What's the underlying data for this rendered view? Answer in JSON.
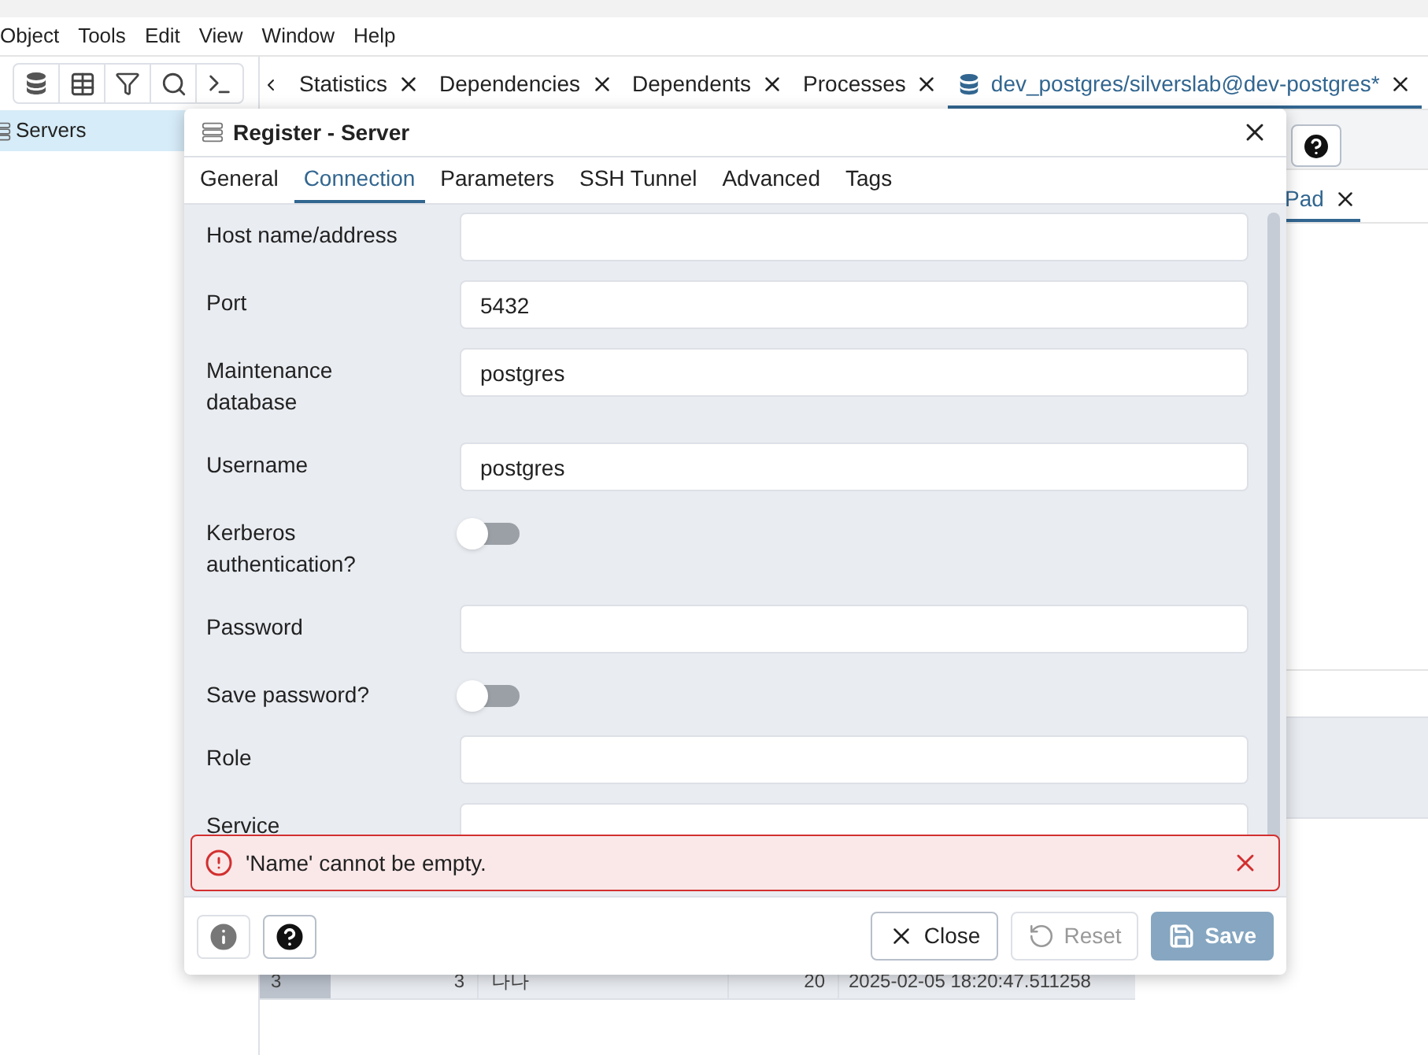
{
  "menu": [
    "Object",
    "Tools",
    "Edit",
    "View",
    "Window",
    "Help"
  ],
  "tabs": [
    {
      "label": "Statistics",
      "selected": false,
      "icon": false
    },
    {
      "label": "Dependencies",
      "selected": false,
      "icon": false
    },
    {
      "label": "Dependents",
      "selected": false,
      "icon": false
    },
    {
      "label": "Processes",
      "selected": false,
      "icon": false
    },
    {
      "label": "dev_postgres/silverslab@dev-postgres*",
      "selected": true,
      "icon": true
    }
  ],
  "tree": [
    {
      "label": "Servers",
      "selected": true
    }
  ],
  "background": {
    "pad_tab": "Pad",
    "row": [
      "3",
      "3",
      "나나",
      "20",
      "2025-02-05 18:20:47.511258"
    ]
  },
  "dialog": {
    "title": "Register - Server",
    "tabs": [
      {
        "label": "General",
        "selected": false
      },
      {
        "label": "Connection",
        "selected": true
      },
      {
        "label": "Parameters",
        "selected": false
      },
      {
        "label": "SSH Tunnel",
        "selected": false
      },
      {
        "label": "Advanced",
        "selected": false
      },
      {
        "label": "Tags",
        "selected": false
      }
    ],
    "fields": [
      {
        "kind": "text",
        "label": "Host name/address"
      },
      {
        "kind": "text",
        "label": "Port",
        "value": "5432"
      },
      {
        "kind": "text",
        "label": "Maintenance database",
        "value": "postgres"
      },
      {
        "kind": "text",
        "label": "Username",
        "value": "postgres"
      },
      {
        "kind": "switch",
        "label": "Kerberos authentication?",
        "on": false
      },
      {
        "kind": "text",
        "label": "Password"
      },
      {
        "kind": "switch",
        "label": "Save password?",
        "on": false
      },
      {
        "kind": "text",
        "label": "Role"
      },
      {
        "kind": "text",
        "label": "Service"
      }
    ],
    "error": "'Name' cannot be empty.",
    "buttons": [
      {
        "kind": "close",
        "label": "Close",
        "disabled": false
      },
      {
        "kind": "reset",
        "label": "Reset",
        "disabled": true
      },
      {
        "kind": "save",
        "label": "Save",
        "disabled": true
      }
    ]
  }
}
